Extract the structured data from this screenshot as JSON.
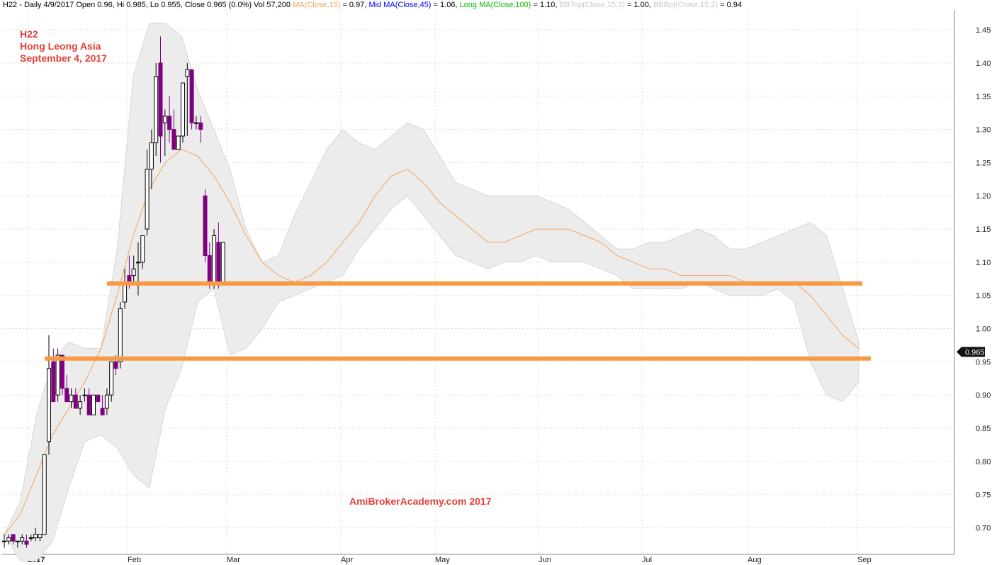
{
  "header": {
    "symbol": "H22 - Daily 4/9/2017",
    "ohlc": "Open 0.96, Hi 0.985, Lo 0.955, Close 0.965 (0.0%) Vol 57,200",
    "ma15_label": "MA(Close,15)",
    "ma15_value": "= 0.97,",
    "mid_label": "Mid MA(Close,45)",
    "mid_value": "= 1.06,",
    "long_label": "Long MA(Close,100)",
    "long_value": "= 1.10,",
    "bbtop_label": "BBTop(Close,15,2)",
    "bbtop_value": "= 1.00,",
    "bbbot_label": "BBBot(Close,15,2)",
    "bbbot_value": "= 0.94"
  },
  "annotation": {
    "line1": "H22",
    "line2": "Hong Leong Asia",
    "line3": "September 4, 2017",
    "watermark": "AmiBrokerAcademy.com  2017"
  },
  "colors": {
    "up_fill": "#ffffff",
    "down_fill": "#800080",
    "ma15": "#f5a25a",
    "band_fill": "#ececec",
    "band_edge": "#d0d0d0",
    "support": "#f79a45",
    "grid": "#d8d8d8",
    "annotation": "#e2413a",
    "mid_ma_label": "#0000ff",
    "long_ma_label": "#00c000",
    "ma15_label": "#f5a25a",
    "bb_label": "#c8c8c8"
  },
  "chart_data": {
    "type": "candlestick",
    "title": "H22 - Daily",
    "x_labels": [
      "2017",
      "Feb",
      "Mar",
      "Apr",
      "May",
      "Jun",
      "Jul",
      "Aug",
      "Sep"
    ],
    "y_ticks": [
      "0.70",
      "0.75",
      "0.80",
      "0.85",
      "0.90",
      "0.95",
      "1.00",
      "1.05",
      "1.10",
      "1.15",
      "1.20",
      "1.25",
      "1.30",
      "1.35",
      "1.40",
      "1.45"
    ],
    "ylim": [
      0.66,
      1.48
    ],
    "last_price_label": "0.965",
    "last_price": 0.965,
    "support_levels": [
      1.068,
      0.955
    ],
    "ma15": [
      0.69,
      0.72,
      0.78,
      0.84,
      0.88,
      0.92,
      0.97,
      1.05,
      1.14,
      1.21,
      1.25,
      1.27,
      1.26,
      1.23,
      1.19,
      1.14,
      1.1,
      1.08,
      1.07,
      1.08,
      1.1,
      1.13,
      1.16,
      1.2,
      1.23,
      1.24,
      1.22,
      1.19,
      1.17,
      1.15,
      1.13,
      1.13,
      1.14,
      1.15,
      1.15,
      1.15,
      1.14,
      1.13,
      1.11,
      1.1,
      1.09,
      1.09,
      1.08,
      1.08,
      1.08,
      1.08,
      1.07,
      1.07,
      1.07,
      1.07,
      1.05,
      1.02,
      0.99,
      0.97
    ],
    "bb_top": [
      0.69,
      0.74,
      0.87,
      0.95,
      0.98,
      0.97,
      0.97,
      1.12,
      1.38,
      1.46,
      1.46,
      1.44,
      1.36,
      1.3,
      1.24,
      1.15,
      1.1,
      1.11,
      1.17,
      1.22,
      1.27,
      1.3,
      1.28,
      1.27,
      1.29,
      1.31,
      1.3,
      1.26,
      1.22,
      1.21,
      1.2,
      1.2,
      1.2,
      1.2,
      1.19,
      1.18,
      1.16,
      1.14,
      1.12,
      1.12,
      1.13,
      1.13,
      1.14,
      1.15,
      1.14,
      1.12,
      1.12,
      1.13,
      1.14,
      1.15,
      1.16,
      1.14,
      1.06,
      0.98
    ],
    "bb_bot": [
      0.69,
      0.65,
      0.65,
      0.68,
      0.76,
      0.83,
      0.84,
      0.82,
      0.78,
      0.76,
      0.88,
      0.94,
      1.04,
      1.06,
      0.96,
      0.97,
      1.0,
      1.04,
      1.05,
      1.06,
      1.07,
      1.08,
      1.12,
      1.15,
      1.18,
      1.2,
      1.17,
      1.14,
      1.11,
      1.1,
      1.09,
      1.1,
      1.1,
      1.11,
      1.1,
      1.1,
      1.1,
      1.09,
      1.08,
      1.06,
      1.06,
      1.06,
      1.06,
      1.07,
      1.06,
      1.05,
      1.05,
      1.05,
      1.06,
      1.04,
      0.95,
      0.9,
      0.89,
      0.92
    ],
    "series": [
      [
        0.68,
        0.69,
        0.67,
        0.68
      ],
      [
        0.68,
        0.69,
        0.675,
        0.685
      ],
      [
        0.69,
        0.69,
        0.675,
        0.68
      ],
      [
        0.68,
        0.68,
        0.67,
        0.68
      ],
      [
        0.68,
        0.69,
        0.675,
        0.685
      ],
      [
        0.68,
        0.69,
        0.67,
        0.675
      ],
      [
        0.685,
        0.69,
        0.68,
        0.685
      ],
      [
        0.685,
        0.7,
        0.68,
        0.69
      ],
      [
        0.685,
        0.69,
        0.68,
        0.69
      ],
      [
        0.69,
        0.72,
        0.69,
        0.81
      ],
      [
        0.83,
        0.99,
        0.81,
        0.94
      ],
      [
        0.95,
        0.97,
        0.89,
        0.89
      ],
      [
        0.9,
        0.97,
        0.89,
        0.96
      ],
      [
        0.96,
        0.96,
        0.9,
        0.91
      ],
      [
        0.91,
        0.93,
        0.89,
        0.89
      ],
      [
        0.89,
        0.91,
        0.88,
        0.9
      ],
      [
        0.9,
        0.91,
        0.88,
        0.88
      ],
      [
        0.88,
        0.9,
        0.87,
        0.89
      ],
      [
        0.9,
        0.91,
        0.89,
        0.9
      ],
      [
        0.9,
        0.91,
        0.87,
        0.87
      ],
      [
        0.87,
        0.9,
        0.87,
        0.9
      ],
      [
        0.9,
        0.9,
        0.89,
        0.89
      ],
      [
        0.88,
        0.9,
        0.87,
        0.87
      ],
      [
        0.88,
        0.91,
        0.87,
        0.9
      ],
      [
        0.9,
        0.95,
        0.89,
        0.95
      ],
      [
        0.95,
        0.96,
        0.93,
        0.94
      ],
      [
        0.95,
        1.04,
        0.94,
        1.03
      ],
      [
        1.04,
        1.09,
        1.03,
        1.07
      ],
      [
        1.08,
        1.11,
        1.06,
        1.07
      ],
      [
        1.08,
        1.11,
        1.07,
        1.09
      ],
      [
        1.1,
        1.13,
        1.05,
        1.1
      ],
      [
        1.1,
        1.14,
        1.09,
        1.14
      ],
      [
        1.15,
        1.27,
        1.14,
        1.24
      ],
      [
        1.24,
        1.3,
        1.21,
        1.28
      ],
      [
        1.28,
        1.4,
        1.26,
        1.38
      ],
      [
        1.4,
        1.44,
        1.25,
        1.29
      ],
      [
        1.31,
        1.33,
        1.26,
        1.32
      ],
      [
        1.32,
        1.35,
        1.28,
        1.3
      ],
      [
        1.3,
        1.33,
        1.27,
        1.27
      ],
      [
        1.27,
        1.29,
        1.27,
        1.29
      ],
      [
        1.29,
        1.37,
        1.28,
        1.37
      ],
      [
        1.38,
        1.4,
        1.29,
        1.39
      ],
      [
        1.39,
        1.39,
        1.3,
        1.31
      ],
      [
        1.31,
        1.32,
        1.3,
        1.31
      ],
      [
        1.31,
        1.32,
        1.28,
        1.3
      ],
      [
        1.2,
        1.21,
        1.1,
        1.11
      ],
      [
        1.11,
        1.13,
        1.06,
        1.07
      ],
      [
        1.07,
        1.15,
        1.06,
        1.14
      ],
      [
        1.13,
        1.16,
        1.06,
        1.07
      ],
      [
        1.07,
        1.13,
        1.07,
        1.13
      ]
    ]
  }
}
